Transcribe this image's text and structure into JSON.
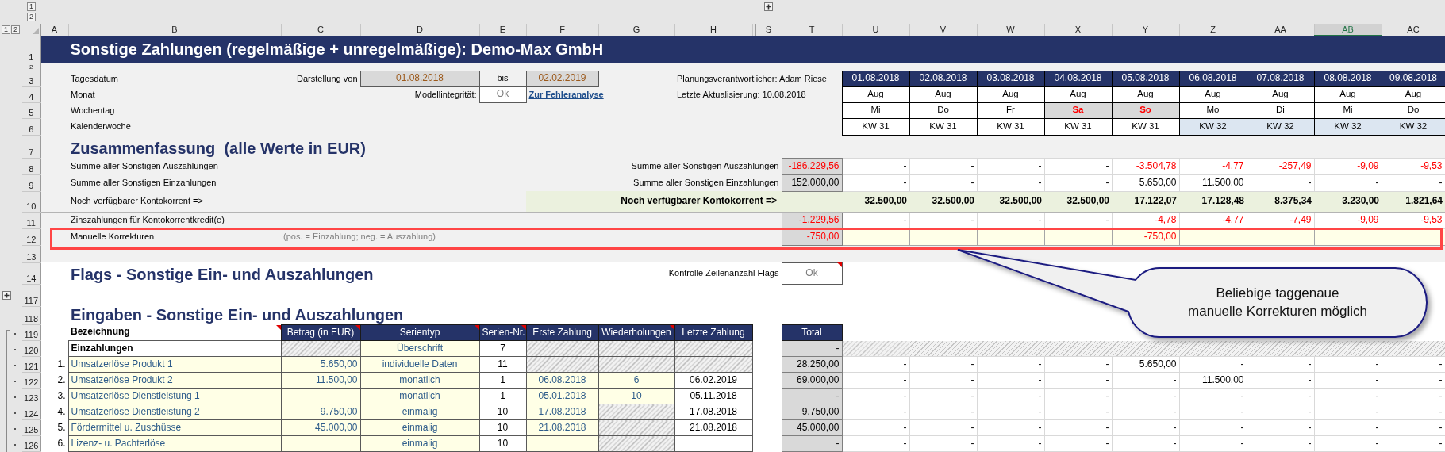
{
  "outline": {
    "column_levels": [
      "1",
      "2"
    ],
    "row_levels": [
      "1",
      "2"
    ]
  },
  "columns": [
    {
      "label": "A",
      "selected": false
    },
    {
      "label": "B",
      "selected": false
    },
    {
      "label": "C",
      "selected": false
    },
    {
      "label": "D",
      "selected": false
    },
    {
      "label": "E",
      "selected": false
    },
    {
      "label": "F",
      "selected": false
    },
    {
      "label": "G",
      "selected": false
    },
    {
      "label": "H",
      "selected": false
    },
    {
      "label": "S",
      "selected": false
    },
    {
      "label": "T",
      "selected": false
    },
    {
      "label": "U",
      "selected": false
    },
    {
      "label": "V",
      "selected": false
    },
    {
      "label": "W",
      "selected": false
    },
    {
      "label": "X",
      "selected": false
    },
    {
      "label": "Y",
      "selected": false
    },
    {
      "label": "Z",
      "selected": false
    },
    {
      "label": "AA",
      "selected": false
    },
    {
      "label": "AB",
      "selected": true
    },
    {
      "label": "AC",
      "selected": false
    }
  ],
  "row_numbers": [
    "1",
    "2",
    "3",
    "4",
    "5",
    "6",
    "7",
    "8",
    "9",
    "10",
    "11",
    "12",
    "13",
    "14",
    "117",
    "118",
    "119",
    "120",
    "121",
    "122",
    "123",
    "124",
    "125",
    "126"
  ],
  "title": "Sonstige Zahlungen (regelmäßige + unregelmäßige): Demo-Max GmbH",
  "info": {
    "labels": [
      "Tagesdatum",
      "Monat",
      "Wochentag",
      "Kalenderwoche"
    ],
    "range_label": "Darstellung von",
    "range_from": "01.08.2018",
    "range_separator": "bis",
    "range_to": "02.02.2019",
    "integrity_label": "Modellintegrität:",
    "integrity_value": "Ok",
    "error_link": "Zur Fehleranalyse",
    "planner": "Planungsverantwortlicher: Adam Riese",
    "updated": "Letzte Aktualisierung: 10.08.2018"
  },
  "days": [
    {
      "date": "01.08.2018",
      "month": "Aug",
      "weekday": "Mi",
      "weekend": false,
      "week": "KW 31",
      "shaded": false
    },
    {
      "date": "02.08.2018",
      "month": "Aug",
      "weekday": "Do",
      "weekend": false,
      "week": "KW 31",
      "shaded": false
    },
    {
      "date": "03.08.2018",
      "month": "Aug",
      "weekday": "Fr",
      "weekend": false,
      "week": "KW 31",
      "shaded": false
    },
    {
      "date": "04.08.2018",
      "month": "Aug",
      "weekday": "Sa",
      "weekend": true,
      "week": "KW 31",
      "shaded": false
    },
    {
      "date": "05.08.2018",
      "month": "Aug",
      "weekday": "So",
      "weekend": true,
      "week": "KW 31",
      "shaded": false
    },
    {
      "date": "06.08.2018",
      "month": "Aug",
      "weekday": "Mo",
      "weekend": false,
      "week": "KW 32",
      "shaded": true
    },
    {
      "date": "07.08.2018",
      "month": "Aug",
      "weekday": "Di",
      "weekend": false,
      "week": "KW 32",
      "shaded": true
    },
    {
      "date": "08.08.2018",
      "month": "Aug",
      "weekday": "Mi",
      "weekend": false,
      "week": "KW 32",
      "shaded": true
    },
    {
      "date": "09.08.2018",
      "month": "Aug",
      "weekday": "Do",
      "weekend": false,
      "week": "KW 32",
      "shaded": true
    }
  ],
  "summary": {
    "heading": "Zusammenfassung  (alle Werte in EUR)",
    "rows": [
      {
        "kind": "sum",
        "label": "Summe aller Sonstigen Auszahlungen",
        "right_label": "Summe aller Sonstigen Auszahlungen",
        "total": {
          "text": "-186.229,56",
          "negative": true
        },
        "values": [
          {
            "text": "-",
            "negative": false
          },
          {
            "text": "-",
            "negative": false
          },
          {
            "text": "-",
            "negative": false
          },
          {
            "text": "-",
            "negative": false
          },
          {
            "text": "-3.504,78",
            "negative": true
          },
          {
            "text": "-4,77",
            "negative": true
          },
          {
            "text": "-257,49",
            "negative": true
          },
          {
            "text": "-9,09",
            "negative": true
          },
          {
            "text": "-9,53",
            "negative": true
          }
        ]
      },
      {
        "kind": "sum",
        "label": "Summe aller Sonstigen Einzahlungen",
        "right_label": "Summe aller Sonstigen Einzahlungen",
        "total": {
          "text": "152.000,00",
          "negative": false
        },
        "values": [
          {
            "text": "-",
            "negative": false
          },
          {
            "text": "-",
            "negative": false
          },
          {
            "text": "-",
            "negative": false
          },
          {
            "text": "-",
            "negative": false
          },
          {
            "text": "5.650,00",
            "negative": false
          },
          {
            "text": "11.500,00",
            "negative": false
          },
          {
            "text": "-",
            "negative": false
          },
          {
            "text": "-",
            "negative": false
          },
          {
            "text": "-",
            "negative": false
          }
        ]
      },
      {
        "kind": "balance",
        "label": "Noch verfügbarer Kontokorrent =>",
        "right_label": "Noch verfügbarer Kontokorrent =>",
        "values": [
          {
            "text": "32.500,00",
            "negative": false
          },
          {
            "text": "32.500,00",
            "negative": false
          },
          {
            "text": "32.500,00",
            "negative": false
          },
          {
            "text": "32.500,00",
            "negative": false
          },
          {
            "text": "17.122,07",
            "negative": false
          },
          {
            "text": "17.128,48",
            "negative": false
          },
          {
            "text": "8.375,34",
            "negative": false
          },
          {
            "text": "3.230,00",
            "negative": false
          },
          {
            "text": "1.821,64",
            "negative": false
          }
        ]
      },
      {
        "kind": "sum",
        "label": "Zinszahlungen für Kontokorrentkredit(e)",
        "total": {
          "text": "-1.229,56",
          "negative": true
        },
        "values": [
          {
            "text": "-",
            "negative": false
          },
          {
            "text": "-",
            "negative": false
          },
          {
            "text": "-",
            "negative": false
          },
          {
            "text": "-",
            "negative": false
          },
          {
            "text": "-4,78",
            "negative": true
          },
          {
            "text": "-4,77",
            "negative": true
          },
          {
            "text": "-7,49",
            "negative": true
          },
          {
            "text": "-9,09",
            "negative": true
          },
          {
            "text": "-9,53",
            "negative": true
          }
        ]
      },
      {
        "kind": "entry",
        "label": "Manuelle Korrekturen",
        "hint": "(pos. = Einzahlung; neg. = Auszahlung)",
        "total": {
          "text": "-750,00",
          "negative": true
        },
        "marked": true,
        "values": [
          {
            "editable": true
          },
          {
            "editable": true
          },
          {
            "editable": true
          },
          {
            "editable": true
          },
          {
            "text": "-750,00",
            "negative": true,
            "editable": true
          },
          {
            "editable": true
          },
          {
            "editable": true
          },
          {
            "editable": true
          },
          {
            "editable": true
          }
        ]
      }
    ]
  },
  "flags": {
    "heading": "Flags - Sonstige Ein- und Auszahlungen",
    "check_label": "Kontrolle Zeilenanzahl Flags",
    "check_value": "Ok",
    "check_comment": true
  },
  "inputs": {
    "heading": "Eingaben - Sonstige Ein- und Auszahlungen",
    "columns": [
      {
        "label": "Bezeichnung",
        "comment": true
      },
      {
        "label": "Betrag (in EUR)",
        "comment": true
      },
      {
        "label": "Serientyp",
        "comment": true
      },
      {
        "label": "Serien-Nr.",
        "comment": true
      },
      {
        "label": "Erste Zahlung",
        "comment": false
      },
      {
        "label": "Wiederholungen",
        "comment": true
      },
      {
        "label": "Letzte Zahlung",
        "comment": false
      }
    ],
    "total_header": "Total",
    "rows": [
      {
        "kind": "group",
        "name": "Einzahlungen",
        "amount": {
          "hatched": true
        },
        "series": "Überschrift",
        "number": "7",
        "first": {
          "hatched": true
        },
        "repeat": {
          "hatched": true
        },
        "last": {
          "hatched": true
        },
        "total": "-",
        "days_hatched": true
      },
      {
        "kind": "item",
        "index": "1.",
        "name": "Umsatzerlöse Produkt 1",
        "amount": {
          "text": "5.650,00",
          "hatched": false
        },
        "series": "individuelle Daten",
        "number": "11",
        "first": {
          "hatched": true
        },
        "repeat": {
          "hatched": true
        },
        "last": {
          "hatched": true
        },
        "total": "28.250,00",
        "days_hatched": false,
        "days": [
          "-",
          "-",
          "-",
          "-",
          "5.650,00",
          "-",
          "-",
          "-",
          "-"
        ]
      },
      {
        "kind": "item",
        "index": "2.",
        "name": "Umsatzerlöse Produkt 2",
        "amount": {
          "text": "11.500,00",
          "hatched": false
        },
        "series": "monatlich",
        "number": "1",
        "first": {
          "text": "06.08.2018",
          "hatched": false
        },
        "repeat": {
          "text": "6",
          "hatched": false
        },
        "last": {
          "text": "06.02.2019",
          "hatched": false
        },
        "total": "69.000,00",
        "days_hatched": false,
        "days": [
          "-",
          "-",
          "-",
          "-",
          "-",
          "11.500,00",
          "-",
          "-",
          "-"
        ]
      },
      {
        "kind": "item",
        "index": "3.",
        "name": "Umsatzerlöse Dienstleistung 1",
        "amount": {
          "hatched": false
        },
        "series": "monatlich",
        "number": "1",
        "first": {
          "text": "05.01.2018",
          "hatched": false
        },
        "repeat": {
          "text": "10",
          "hatched": false
        },
        "last": {
          "text": "05.11.2018",
          "hatched": false
        },
        "total": "-",
        "days_hatched": false,
        "days": [
          "-",
          "-",
          "-",
          "-",
          "-",
          "-",
          "-",
          "-",
          "-"
        ]
      },
      {
        "kind": "item",
        "index": "4.",
        "name": "Umsatzerlöse Dienstleistung 2",
        "amount": {
          "text": "9.750,00",
          "hatched": false
        },
        "series": "einmalig",
        "number": "10",
        "first": {
          "text": "17.08.2018",
          "hatched": false
        },
        "repeat": {
          "hatched": true
        },
        "last": {
          "text": "17.08.2018",
          "hatched": false
        },
        "total": "9.750,00",
        "days_hatched": false,
        "days": [
          "-",
          "-",
          "-",
          "-",
          "-",
          "-",
          "-",
          "-",
          "-"
        ]
      },
      {
        "kind": "item",
        "index": "5.",
        "name": "Fördermittel u. Zuschüsse",
        "amount": {
          "text": "45.000,00",
          "hatched": false
        },
        "series": "einmalig",
        "number": "10",
        "first": {
          "text": "21.08.2018",
          "hatched": false
        },
        "repeat": {
          "hatched": true
        },
        "last": {
          "text": "21.08.2018",
          "hatched": false
        },
        "total": "45.000,00",
        "days_hatched": false,
        "days": [
          "-",
          "-",
          "-",
          "-",
          "-",
          "-",
          "-",
          "-",
          "-"
        ]
      },
      {
        "kind": "item",
        "index": "6.",
        "name": "Lizenz- u. Pachterlöse",
        "amount": {
          "hatched": false
        },
        "series": "einmalig",
        "number": "10",
        "first": {
          "hatched": false
        },
        "repeat": {
          "hatched": true
        },
        "last": {
          "hatched": false
        },
        "total": "-",
        "days_hatched": false,
        "days": [
          "-",
          "-",
          "-",
          "-",
          "-",
          "-",
          "-",
          "-",
          "-"
        ]
      }
    ]
  },
  "callout": {
    "text": "Beliebige taggenaue\nmanuelle Korrekturen möglich"
  }
}
